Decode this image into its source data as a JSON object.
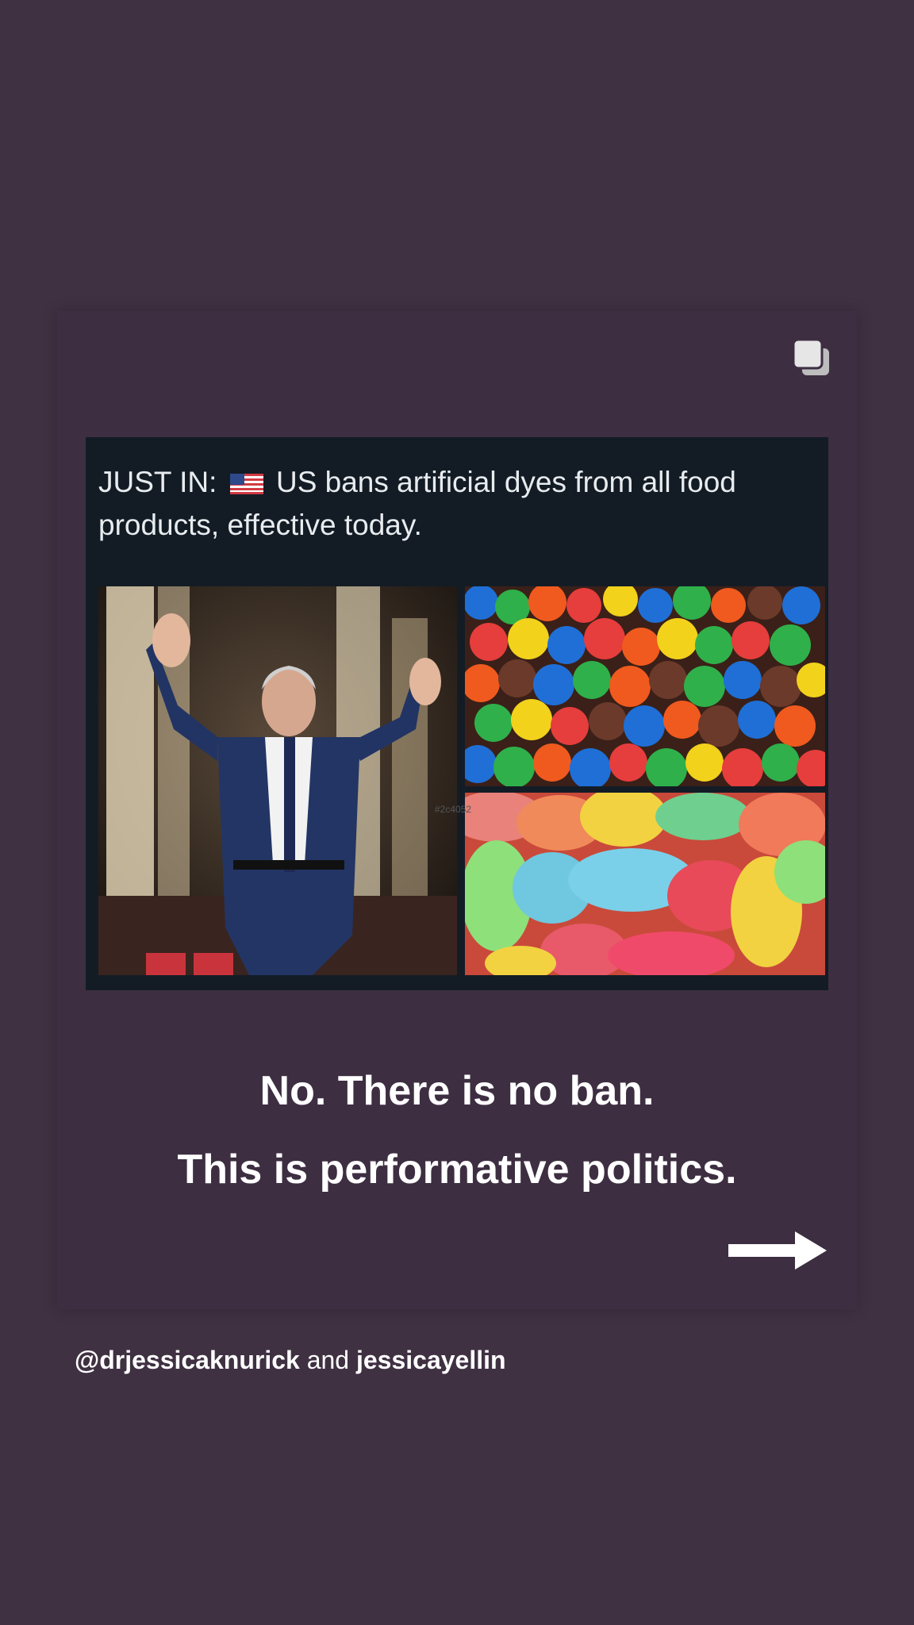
{
  "post": {
    "headline_prefix": "JUST IN:",
    "headline_rest": "US bans artificial dyes from all food products, effective today.",
    "flag_icon": "us-flag-icon",
    "carousel_icon": "multiple-images-icon",
    "watermark": "#2c4052",
    "caption_line1": "No. There is no ban.",
    "caption_line2": "This is performative politics.",
    "next_icon": "right-arrow-icon"
  },
  "attribution": {
    "user1": "@drjessicaknurick",
    "joiner": "and",
    "user2": "jessicayellin"
  },
  "colors": {
    "background": "#3f3042",
    "embed_bg": "#131c25",
    "text": "#ffffff"
  }
}
